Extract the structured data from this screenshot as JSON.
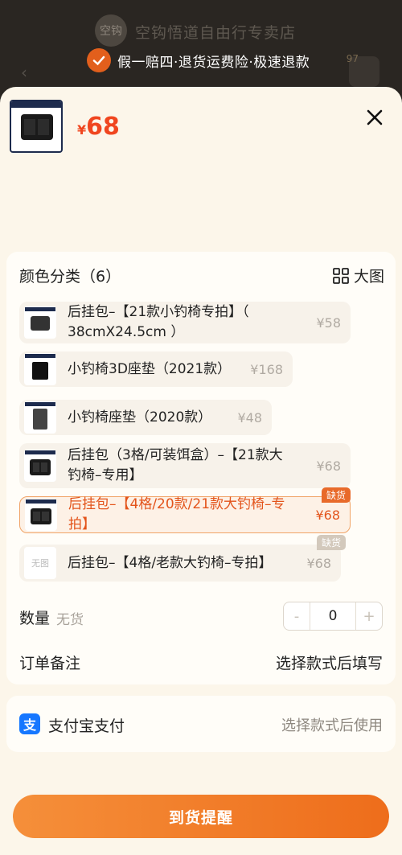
{
  "background": {
    "store_name": "空钩悟道自由行专卖店",
    "logo_text": "空钩",
    "cart_badge": "97",
    "guarantee": "假一赔四·退货运费险·极速退款"
  },
  "product": {
    "currency": "¥",
    "price": "68"
  },
  "variants": {
    "title": "颜色分类（6）",
    "big_pic_label": "大图",
    "options": [
      {
        "label": "后挂包–【21款小钓椅专拍】（ 38cmX24.5cm ）",
        "price": "¥58"
      },
      {
        "label": "小钓椅3D座垫（2021款）",
        "price": "¥168"
      },
      {
        "label": "小钓椅座垫（2020款）",
        "price": "¥48"
      },
      {
        "label": "后挂包（3格/可装饵盒）–【21款大钓椅–专用】",
        "price": "¥68"
      },
      {
        "label": "后挂包–【4格/20款/21款大钓椅–专拍】",
        "price": "¥68",
        "tag": "缺货"
      },
      {
        "label": "后挂包–【4格/老款大钓椅–专拍】",
        "price": "¥68",
        "tag": "缺货",
        "thumb_text": "无图"
      }
    ]
  },
  "quantity": {
    "label": "数量",
    "status": "无货",
    "minus": "-",
    "value": "0",
    "plus": "+"
  },
  "note": {
    "label": "订单备注",
    "value": "选择款式后填写"
  },
  "payment": {
    "icon_char": "支",
    "label": "支付宝支付",
    "value": "选择款式后使用"
  },
  "cta": {
    "label": "到货提醒"
  },
  "colors": {
    "accent": "#f0461f",
    "button": "#ee6d1b",
    "sheet_bg": "#fcf6ea"
  }
}
